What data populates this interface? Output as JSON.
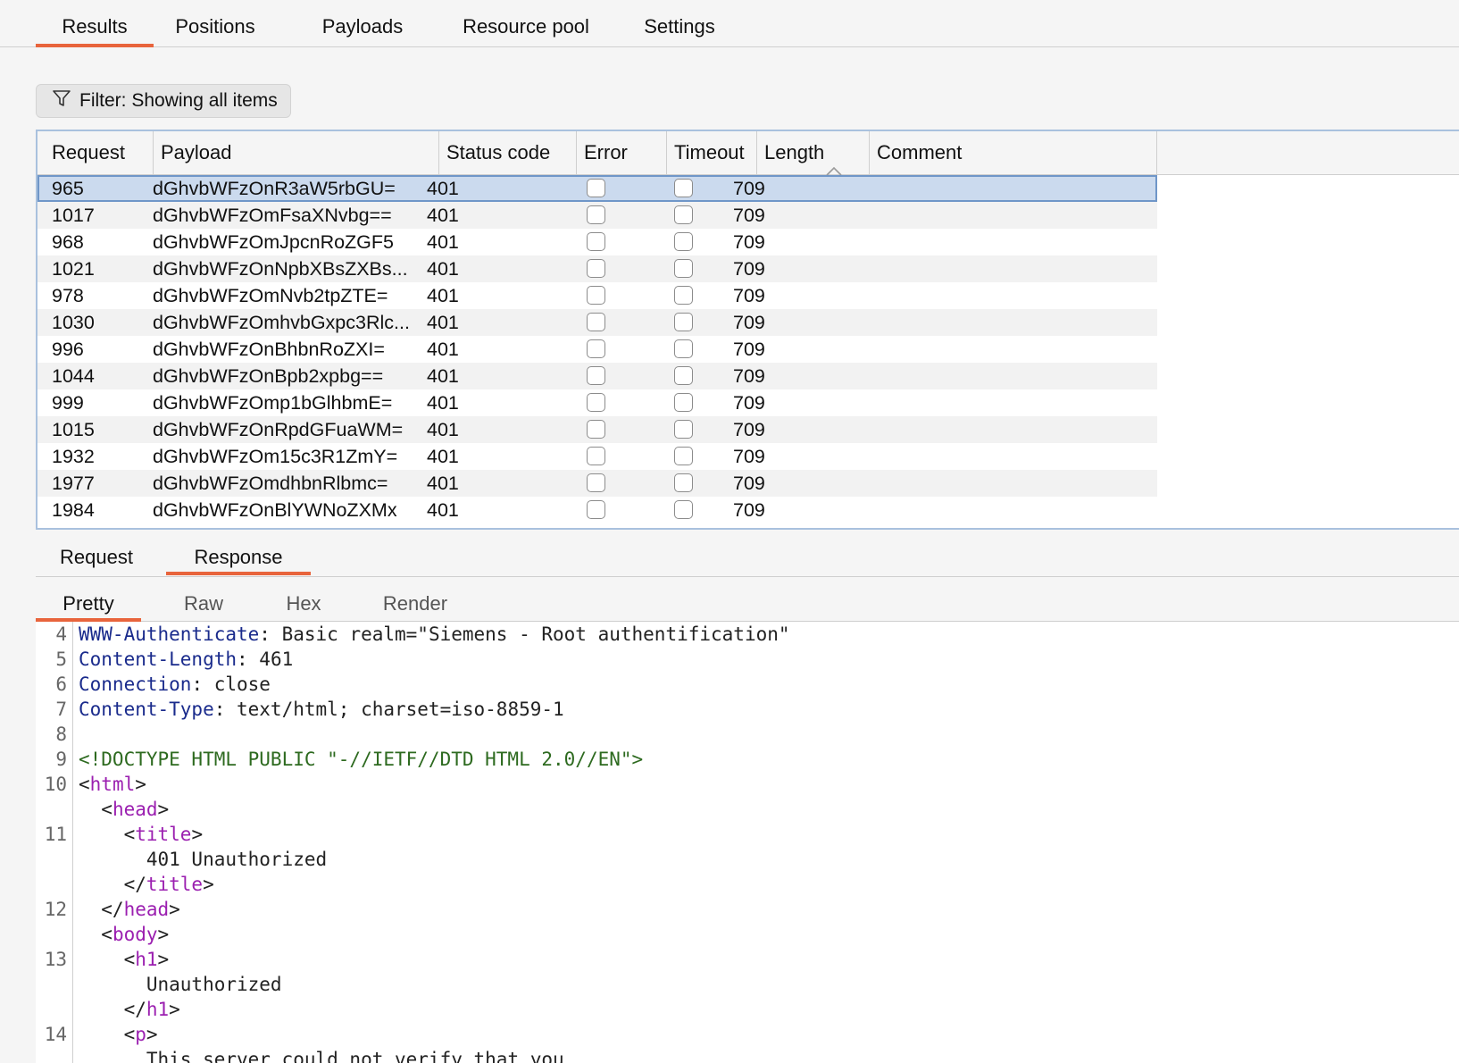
{
  "tabs": [
    "Results",
    "Positions",
    "Payloads",
    "Resource pool",
    "Settings"
  ],
  "filter": {
    "label": "Filter: Showing all items",
    "icon": "filter-icon"
  },
  "table": {
    "columns": [
      "Request",
      "Payload",
      "Status code",
      "Error",
      "Timeout",
      "Length",
      "Comment"
    ],
    "sort_column": "Length",
    "sort_direction": "ascending",
    "rows": [
      {
        "request": "965",
        "payload": "dGhvbWFzOnR3aW5rbGU=",
        "status": "401",
        "length": "709",
        "selected": true
      },
      {
        "request": "1017",
        "payload": "dGhvbWFzOmFsaXNvbg==",
        "status": "401",
        "length": "709"
      },
      {
        "request": "968",
        "payload": "dGhvbWFzOmJpcnRoZGF5",
        "status": "401",
        "length": "709"
      },
      {
        "request": "1021",
        "payload": "dGhvbWFzOnNpbXBsZXBs...",
        "status": "401",
        "length": "709"
      },
      {
        "request": "978",
        "payload": "dGhvbWFzOmNvb2tpZTE=",
        "status": "401",
        "length": "709"
      },
      {
        "request": "1030",
        "payload": "dGhvbWFzOmhvbGxpc3Rlc...",
        "status": "401",
        "length": "709"
      },
      {
        "request": "996",
        "payload": "dGhvbWFzOnBhbnRoZXI=",
        "status": "401",
        "length": "709"
      },
      {
        "request": "1044",
        "payload": "dGhvbWFzOnBpb2xpbg==",
        "status": "401",
        "length": "709"
      },
      {
        "request": "999",
        "payload": "dGhvbWFzOmp1bGlhbmE=",
        "status": "401",
        "length": "709"
      },
      {
        "request": "1015",
        "payload": "dGhvbWFzOnRpdGFuaWM=",
        "status": "401",
        "length": "709"
      },
      {
        "request": "1932",
        "payload": "dGhvbWFzOm15c3R1ZmY=",
        "status": "401",
        "length": "709"
      },
      {
        "request": "1977",
        "payload": "dGhvbWFzOmdhbnRlbmc=",
        "status": "401",
        "length": "709"
      },
      {
        "request": "1984",
        "payload": "dGhvbWFzOnBlYWNoZXMx",
        "status": "401",
        "length": "709"
      }
    ]
  },
  "rr_tabs": [
    "Request",
    "Response"
  ],
  "view_tabs": [
    "Pretty",
    "Raw",
    "Hex",
    "Render"
  ],
  "code": {
    "line_numbers": [
      "4",
      "5",
      "6",
      "7",
      "8",
      "9",
      "10",
      "11",
      "12",
      "13",
      "14"
    ],
    "h1": {
      "key": "WWW-Authenticate",
      "value": ": Basic realm=\"Siemens - Root authentification\""
    },
    "h2": {
      "key": "Content-Length",
      "value": ": 461"
    },
    "h3": {
      "key": "Connection",
      "value": ": close"
    },
    "h4": {
      "key": "Content-Type",
      "value": ": text/html; charset=iso-8859-1"
    },
    "doctype": "<!DOCTYPE HTML PUBLIC \"-//IETF//DTD HTML 2.0//EN\">",
    "tag_html": "html",
    "tag_head": "head",
    "tag_title": "title",
    "title_text": "401 Unauthorized",
    "tag_body": "body",
    "tag_h1": "h1",
    "h1_text": "Unauthorized",
    "tag_p": "p",
    "p_text": "This server could not verify that you"
  },
  "colors": {
    "accent": "#e8643c",
    "selection": "#cbdaee",
    "header_key": "#1a2b8c",
    "tag": "#9b1fb0",
    "doctype": "#2d6a1f"
  }
}
